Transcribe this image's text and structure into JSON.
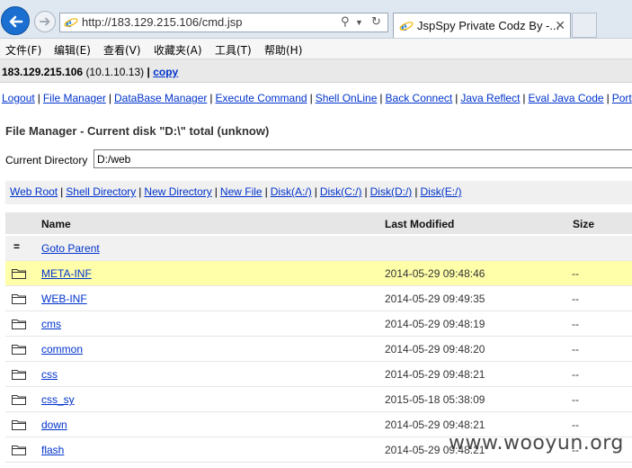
{
  "browser": {
    "url": "http://183.129.215.106/cmd.jsp",
    "tab_title": "JspSpy Private Codz By -...",
    "menu": [
      "文件(F)",
      "编辑(E)",
      "查看(V)",
      "收藏夹(A)",
      "工具(T)",
      "帮助(H)"
    ]
  },
  "host": {
    "ip": "183.129.215.106",
    "local_ip": "(10.1.10.13)",
    "separator": "|",
    "copy": "copy"
  },
  "nav": [
    "Logout",
    "File Manager",
    "DataBase Manager",
    "Execute Command",
    "Shell OnLine",
    "Back Connect",
    "Java Reflect",
    "Eval Java Code",
    "Port"
  ],
  "file_manager": {
    "title": "File Manager - Current disk \"D:\\\" total (unknow)",
    "current_dir_label": "Current Directory",
    "current_dir_value": "D:/web",
    "links": [
      "Web Root",
      "Shell Directory",
      "New Directory",
      "New File",
      "Disk(A:/)",
      "Disk(C:/)",
      "Disk(D:/)",
      "Disk(E:/)"
    ],
    "columns": {
      "name": "Name",
      "modified": "Last Modified",
      "size": "Size"
    },
    "parent": {
      "symbol": "=",
      "label": "Goto Parent"
    },
    "rows": [
      {
        "name": "META-INF",
        "modified": "2014-05-29 09:48:46",
        "size": "--"
      },
      {
        "name": "WEB-INF",
        "modified": "2014-05-29 09:49:35",
        "size": "--"
      },
      {
        "name": "cms",
        "modified": "2014-05-29 09:48:19",
        "size": "--"
      },
      {
        "name": "common",
        "modified": "2014-05-29 09:48:20",
        "size": "--"
      },
      {
        "name": "css",
        "modified": "2014-05-29 09:48:21",
        "size": "--"
      },
      {
        "name": "css_sy",
        "modified": "2015-05-18 05:38:09",
        "size": "--"
      },
      {
        "name": "down",
        "modified": "2014-05-29 09:48:21",
        "size": "--"
      },
      {
        "name": "flash",
        "modified": "2014-05-29 09:48:21",
        "size": "--"
      }
    ]
  },
  "watermark": "www.wooyun.org",
  "colors": {
    "link": "#0033cc",
    "highlight_row": "#ffffaa",
    "header_bg": "#e6e6e6"
  }
}
